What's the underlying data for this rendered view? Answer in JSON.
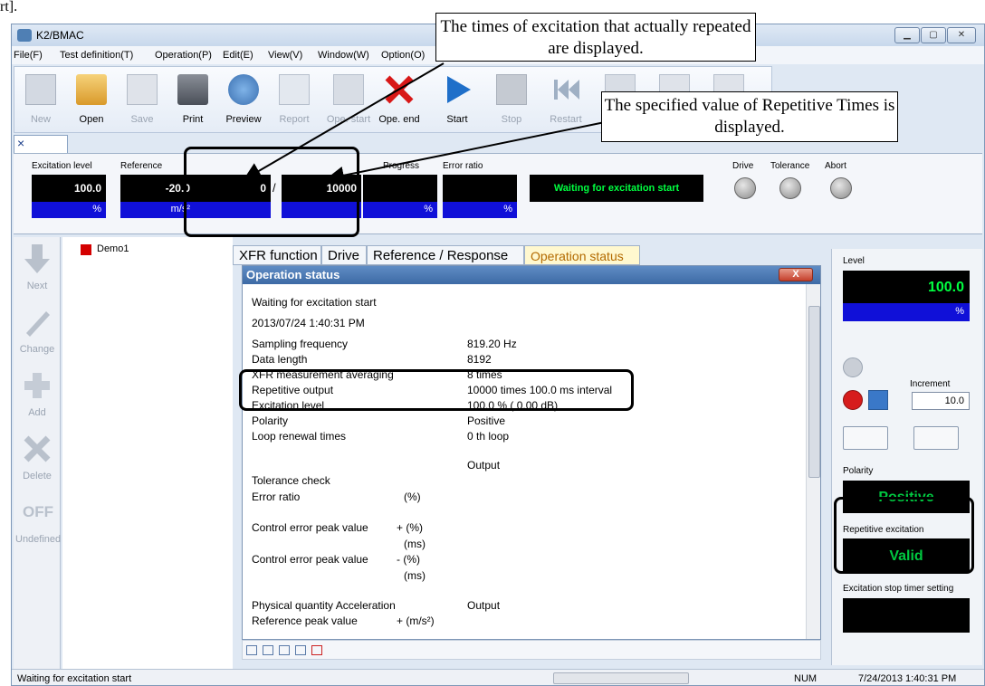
{
  "top_fragment": "rt].",
  "window": {
    "title": "K2/BMAC"
  },
  "menu": [
    "File(F)",
    "Test definition(T)",
    "Operation(P)",
    "Edit(E)",
    "View(V)",
    "Window(W)",
    "Option(O)"
  ],
  "toolbar": {
    "new": "New",
    "open": "Open",
    "save": "Save",
    "print": "Print",
    "preview": "Preview",
    "report": "Report",
    "ope_start": "Ope. start",
    "ope_end": "Ope. end",
    "start": "Start",
    "stop": "Stop",
    "restart": "Restart"
  },
  "doc_tab": {
    "close": "×"
  },
  "indicators": {
    "excitation_level": {
      "caption": "Excitation level",
      "value": "100.0",
      "unit": "%"
    },
    "reference": {
      "caption": "Reference",
      "value": "-20.0",
      "unit": "m/s²"
    },
    "repeat_count": {
      "value": "0"
    },
    "separator": "/",
    "repeat_total": {
      "value": "10000"
    },
    "progress": {
      "caption": "Progress",
      "unit": "%"
    },
    "error_ratio": {
      "caption": "Error ratio",
      "unit": "%"
    },
    "status": "Waiting for excitation start",
    "drive": "Drive",
    "tolerance": "Tolerance",
    "abort": "Abort"
  },
  "sidebar": {
    "next": "Next",
    "change": "Change",
    "add": "Add",
    "delete": "Delete",
    "undefined": "Undefined",
    "off": "OFF"
  },
  "tree": {
    "item": "Demo1"
  },
  "tabs": [
    "XFR function",
    "Drive",
    "Reference / Response",
    "Operation status"
  ],
  "operation_status": {
    "title": "Operation status",
    "state": "Waiting for excitation start",
    "datetime": "2013/07/24 1:40:31 PM",
    "sampling_frequency_label": "Sampling frequency",
    "sampling_frequency": "819.20 Hz",
    "data_length_label": "Data length",
    "data_length": "8192",
    "xfr_label": "XFR measurement averaging",
    "xfr": "8 times",
    "repetitive_output_label": "Repetitive output",
    "repetitive_output": "10000 times 100.0 ms interval",
    "excitation_level_label": "Excitation level",
    "excitation_level": "100.0 % ( 0.00 dB)",
    "polarity_label": "Polarity",
    "polarity": "Positive",
    "loop_label": "Loop renewal times",
    "loop": "0 th loop",
    "output_header": "Output",
    "tolerance_check": "Tolerance check",
    "error_ratio_label": "Error ratio",
    "error_ratio_unit": "(%)",
    "control_error_plus_label": "Control error peak value",
    "control_error_plus_unit": "+ (%)",
    "ms1": "(ms)",
    "control_error_minus_label": "Control error peak value",
    "control_error_minus_unit": "- (%)",
    "ms2": "(ms)",
    "physical_quantity": "Physical quantity Acceleration",
    "physical_output": "Output",
    "reference_peak_label": "Reference peak value",
    "reference_peak_unit": "+ (m/s²)"
  },
  "right_panel": {
    "level_caption": "Level",
    "level_value": "100.0",
    "level_unit": "%",
    "increment_caption": "Increment",
    "increment_value": "10.0",
    "polarity_caption": "Polarity",
    "polarity_value": "Positive",
    "repetitive_caption": "Repetitive excitation",
    "repetitive_value": "Valid",
    "timer_caption": "Excitation stop timer setting"
  },
  "statusbar": {
    "left": "Waiting for excitation start",
    "num": "NUM",
    "datetime": "7/24/2013  1:40:31 PM"
  },
  "callouts": {
    "top": "The times of excitation that actually repeated are displayed.",
    "right": "The specified value of Repetitive Times is displayed."
  }
}
